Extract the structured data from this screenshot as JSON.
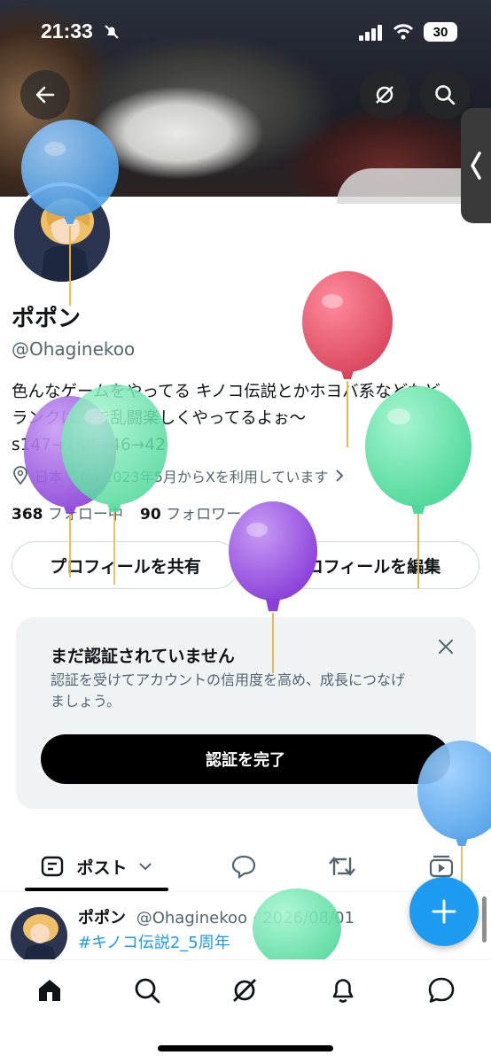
{
  "status_bar": {
    "time": "21:33",
    "battery": "30"
  },
  "profile": {
    "display_name": "ポポン",
    "handle": "@Ohaginekoo",
    "bio_line1": "色んなゲームをやってる キノコ伝説とかホヨバ系などなど",
    "bio_line2": "ランクは人で乱闘楽しくやってるよぉ〜",
    "bio_line3": "s147→144→46→42",
    "location": "日本",
    "joined": "2023年5月からXを利用しています",
    "following_count": "368",
    "following_label": "フォロー中",
    "followers_count": "90",
    "followers_label": "フォロワー"
  },
  "actions": {
    "share_label": "プロフィールを共有",
    "edit_label": "プロフィールを編集"
  },
  "verify_card": {
    "title": "まだ認証されていません",
    "body_line1": "認証を受けてアカウントの信用度を高め、成長につなげ",
    "body_line2": "ましょう。",
    "button_label": "認証を完了"
  },
  "tabs": {
    "posts_label": "ポスト"
  },
  "post_preview": {
    "author": "ポポン",
    "meta": "@Ohaginekoo · 2026/08/01",
    "hashtag": "#キノコ伝説2_5周年"
  },
  "icons": [
    "back-arrow-icon",
    "grok-icon",
    "search-icon",
    "chevron-left-icon",
    "location-icon",
    "calendar-icon",
    "close-icon",
    "posts-icon",
    "chevron-down-icon",
    "reply-icon",
    "repost-icon",
    "video-icon",
    "plus-icon",
    "home-icon",
    "notifications-icon",
    "messages-icon"
  ],
  "colors": {
    "accent": "#1d9bf0",
    "balloon_blue": "#5aa9f0",
    "balloon_red": "#e4546a",
    "balloon_green": "#5fe0a6",
    "balloon_purple": "#9a4fe0"
  }
}
